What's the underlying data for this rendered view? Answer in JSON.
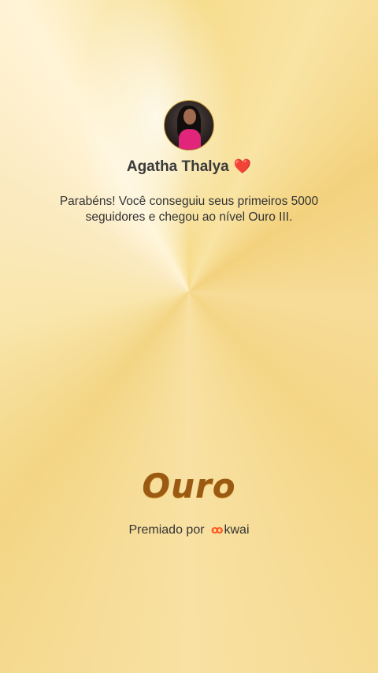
{
  "profile": {
    "name": "Agatha Thalya",
    "name_emoji": "❤️"
  },
  "message": "Parabéns! Você conseguiu seus primeiros 5000 seguidores e chegou ao nível Ouro III.",
  "badge": {
    "title": "Ouro"
  },
  "footer": {
    "awarded_by": "Premiado por",
    "brand_icon": "kwai-logo-icon",
    "brand_name": "kwai"
  },
  "colors": {
    "badge_text": "#9a5a12",
    "brand_accent": "#ff5a1f",
    "background_gold": "#f6dc8c"
  }
}
